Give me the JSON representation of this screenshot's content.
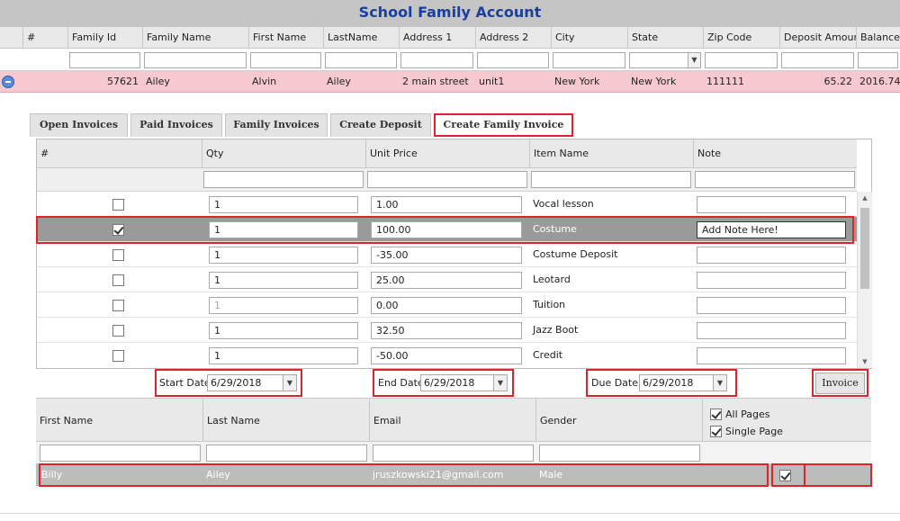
{
  "title": "School Family Account",
  "grid": {
    "headers": [
      "#",
      "Family Id",
      "Family Name",
      "First Name",
      "LastName",
      "Address 1",
      "Address 2",
      "City",
      "State",
      "Zip Code",
      "Deposit Amoun",
      "Balance"
    ],
    "row": {
      "family_id": "57621",
      "family_name": "Ailey",
      "first_name": "Alvin",
      "last_name": "Ailey",
      "address1": "2 main street",
      "address2": "unit1",
      "city": "New York",
      "state": "New York",
      "zip": "111111",
      "deposit": "65.22",
      "balance": "2016.74"
    }
  },
  "tabs": [
    "Open Invoices",
    "Paid Invoices",
    "Family Invoices",
    "Create Deposit",
    "Create Family Invoice"
  ],
  "invoice_grid": {
    "headers": [
      "#",
      "Qty",
      "Unit Price",
      "Item Name",
      "Note"
    ],
    "rows": [
      {
        "checked": false,
        "qty": "1",
        "price": "1.00",
        "item": "Vocal lesson",
        "note": ""
      },
      {
        "checked": true,
        "qty": "1",
        "price": "100.00",
        "item": "Costume",
        "note": "Add Note Here!"
      },
      {
        "checked": false,
        "qty": "1",
        "price": "-35.00",
        "item": "Costume Deposit",
        "note": ""
      },
      {
        "checked": false,
        "qty": "1",
        "price": "25.00",
        "item": "Leotard",
        "note": ""
      },
      {
        "checked": false,
        "qty": "1",
        "price": "0.00",
        "item": "Tuition",
        "note": ""
      },
      {
        "checked": false,
        "qty": "1",
        "price": "32.50",
        "item": "Jazz Boot",
        "note": ""
      },
      {
        "checked": false,
        "qty": "1",
        "price": "-50.00",
        "item": "Credit",
        "note": ""
      }
    ]
  },
  "dates": {
    "start_label": "Start Date",
    "start_value": "6/29/2018",
    "end_label": "End Date",
    "end_value": "6/29/2018",
    "due_label": "Due Date:",
    "due_value": "6/29/2018"
  },
  "invoice_button": "Invoice",
  "people_grid": {
    "headers": [
      "First Name",
      "Last Name",
      "Email",
      "Gender"
    ],
    "all_pages": "All Pages",
    "single_page": "Single Page",
    "row": {
      "first": "Billy",
      "last": "Ailey",
      "email": "jruszkowski21@gmail.com",
      "gender": "Male",
      "checked": true
    }
  },
  "icons": {
    "expand": "collapse-minus-icon",
    "dropdown": "chevron-down-icon",
    "checkbox": "checkbox-icon"
  },
  "colors": {
    "title": "#1b3f9c",
    "highlight_row": "#f6c9d1",
    "selected_row": "#9a9a9a",
    "annotation": "#d9262c"
  }
}
